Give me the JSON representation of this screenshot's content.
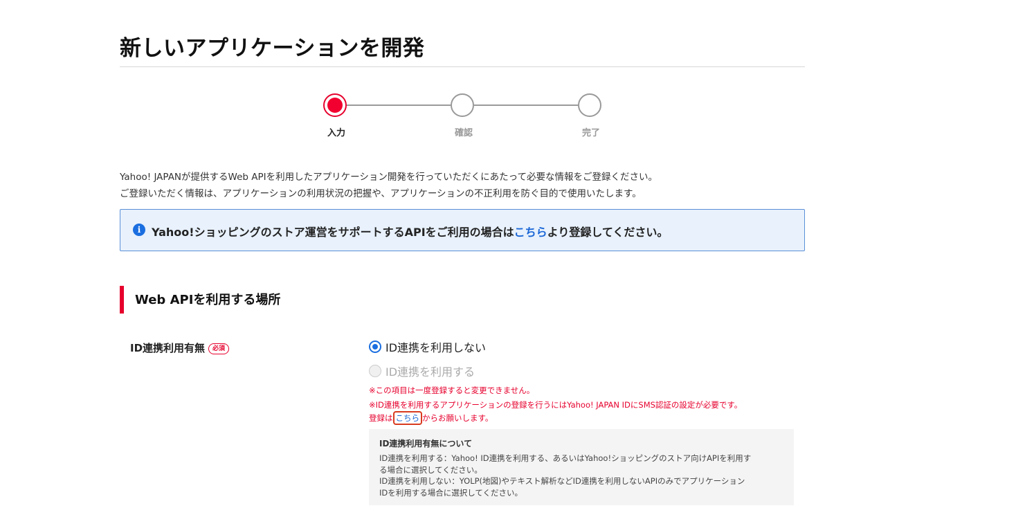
{
  "page": {
    "title": "新しいアプリケーションを開発"
  },
  "stepper": {
    "steps": [
      {
        "label": "入力",
        "state": "active"
      },
      {
        "label": "確認",
        "state": "inactive"
      },
      {
        "label": "完了",
        "state": "inactive"
      }
    ],
    "active_color": "#f2002f"
  },
  "intro": {
    "line1": "Yahoo! JAPANが提供するWeb APIを利用したアプリケーション開発を行っていただくにあたって必要な情報をご登録ください。",
    "line2": "ご登録いただく情報は、アプリケーションの利用状況の把握や、アプリケーションの不正利用を防ぐ目的で使用いたします。"
  },
  "info_box": {
    "icon": "info-icon",
    "prefix": "Yahoo!ショッピングのストア運営をサポートするAPIをご利用の場合は",
    "link": "こちら",
    "suffix": "より登録してください。"
  },
  "section": {
    "title": "Web APIを利用する場所",
    "accent_color": "#e6002d"
  },
  "id_field": {
    "label": "ID連携利用有無",
    "required_badge": "必須",
    "options": [
      {
        "label": "ID連携を利用しない",
        "selected": true,
        "disabled": false
      },
      {
        "label": "ID連携を利用する",
        "selected": false,
        "disabled": true
      }
    ],
    "warning1": "※この項目は一度登録すると変更できません。",
    "warning2": "※ID連携を利用するアプリケーションの登録を行うにはYahoo! JAPAN IDにSMS認証の設定が必要です。",
    "warning3_prefix": "登録は",
    "warning3_link": "こちら",
    "warning3_suffix": "からお願いします。"
  },
  "note": {
    "title": "ID連携利用有無について",
    "line1": "ID連携を利用する：Yahoo! ID連携を利用する、あるいはYahoo!ショッピングのストア向けAPIを利用す",
    "line2": "る場合に選択してください。",
    "line3": "ID連携を利用しない：YOLP(地図)やテキスト解析などID連携を利用しないAPIのみでアプリケーション",
    "line4": "IDを利用する場合に選択してください。"
  }
}
